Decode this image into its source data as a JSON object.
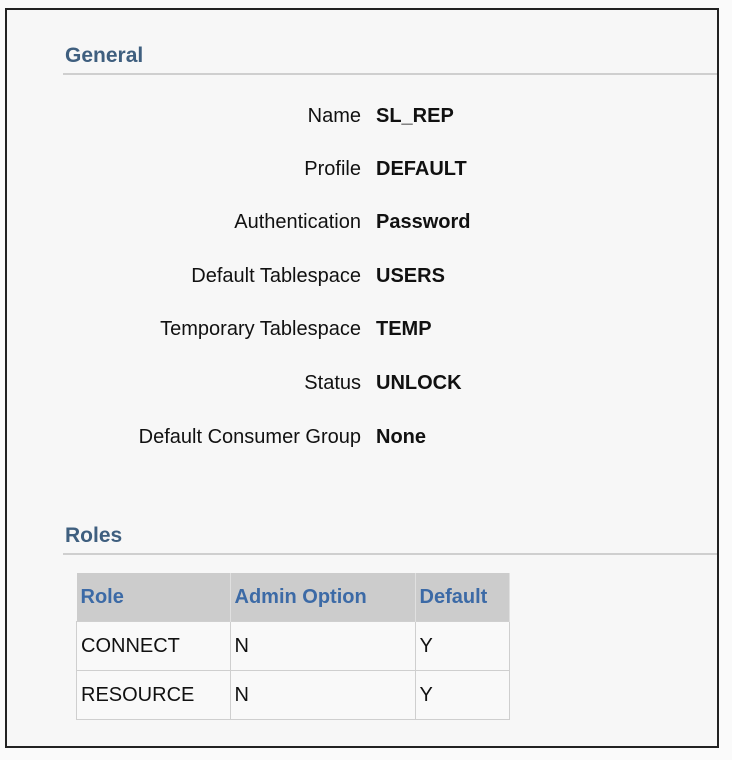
{
  "general": {
    "title": "General",
    "fields": [
      {
        "label": "Name",
        "value": "SL_REP"
      },
      {
        "label": "Profile",
        "value": "DEFAULT"
      },
      {
        "label": "Authentication",
        "value": "Password"
      },
      {
        "label": "Default Tablespace",
        "value": "USERS"
      },
      {
        "label": "Temporary Tablespace",
        "value": "TEMP"
      },
      {
        "label": "Status",
        "value": "UNLOCK"
      },
      {
        "label": "Default Consumer Group",
        "value": "None"
      }
    ]
  },
  "roles": {
    "title": "Roles",
    "columns": [
      "Role",
      "Admin Option",
      "Default"
    ],
    "rows": [
      [
        "CONNECT",
        "N",
        "Y"
      ],
      [
        "RESOURCE",
        "N",
        "Y"
      ]
    ]
  }
}
